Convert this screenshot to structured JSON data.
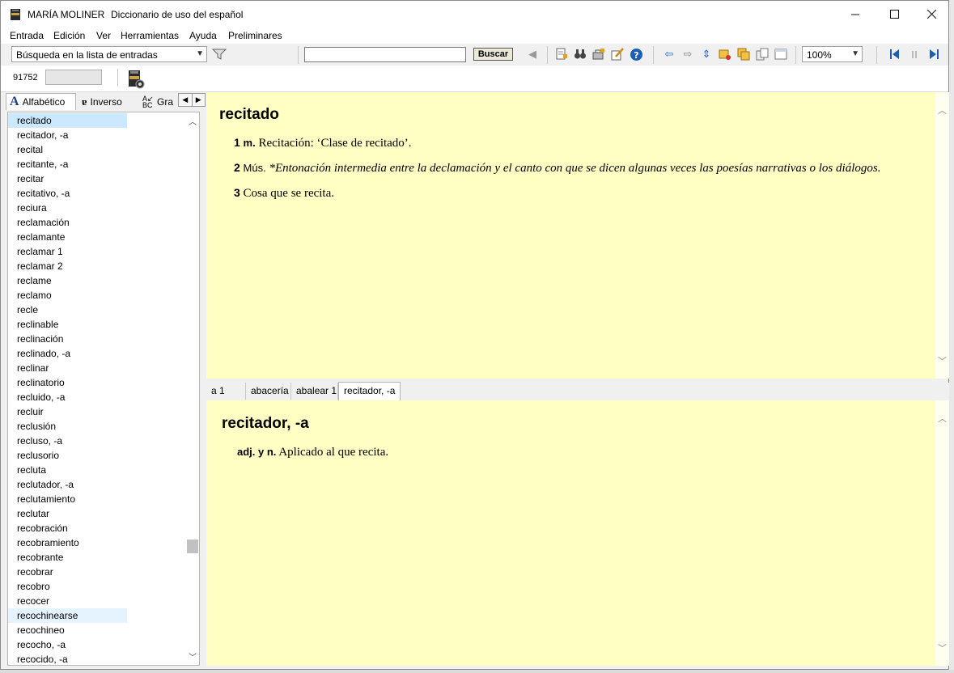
{
  "window": {
    "app_name": "MARÍA MOLINER",
    "subtitle": "Diccionario de uso del español"
  },
  "menu": [
    "Entrada",
    "Edición",
    "Ver",
    "Herramientas",
    "Ayuda",
    "Preliminares"
  ],
  "toolbar": {
    "search_mode": "Búsqueda en la lista de entradas",
    "search_value": "",
    "buscar_label": "Buscar",
    "zoom": "100%"
  },
  "counter": "91752",
  "left_tabs": {
    "alfabetico": "Alfabético",
    "inverso": "Inverso",
    "gra": "Gra"
  },
  "entries": [
    "recitado",
    "recitador, -a",
    "recital",
    "recitante, -a",
    "recitar",
    "recitativo, -a",
    "reciura",
    "reclamación",
    "reclamante",
    "reclamar 1",
    "reclamar 2",
    "reclame",
    "reclamo",
    "recle",
    "reclinable",
    "reclinación",
    "reclinado, -a",
    "reclinar",
    "reclinatorio",
    "recluido, -a",
    "recluir",
    "reclusión",
    "recluso, -a",
    "reclusorio",
    "recluta",
    "reclutador, -a",
    "reclutamiento",
    "reclutar",
    "recobración",
    "recobramiento",
    "recobrante",
    "recobrar",
    "recobro",
    "recocer",
    "recochinearse",
    "recochineo",
    "recocho, -a",
    "recocido, -a"
  ],
  "entry1": {
    "headword": "recitado",
    "defs": [
      {
        "num": "1",
        "gram": "m.",
        "text": "Recitación: ‘Clase de recitado’."
      },
      {
        "num": "2",
        "mark": "Mús.",
        "text": "*Entonación intermedia entre la declamación y el canto con que se dicen algunas veces las poesías narrativas o los diálogos."
      },
      {
        "num": "3",
        "text": "Cosa que se recita."
      }
    ]
  },
  "history_tabs": [
    "a 1",
    "abacería",
    "abalear 1",
    "recitador, -a"
  ],
  "entry2": {
    "headword": "recitador, -a",
    "gram": "adj. y n.",
    "text": "Aplicado al que recita."
  }
}
